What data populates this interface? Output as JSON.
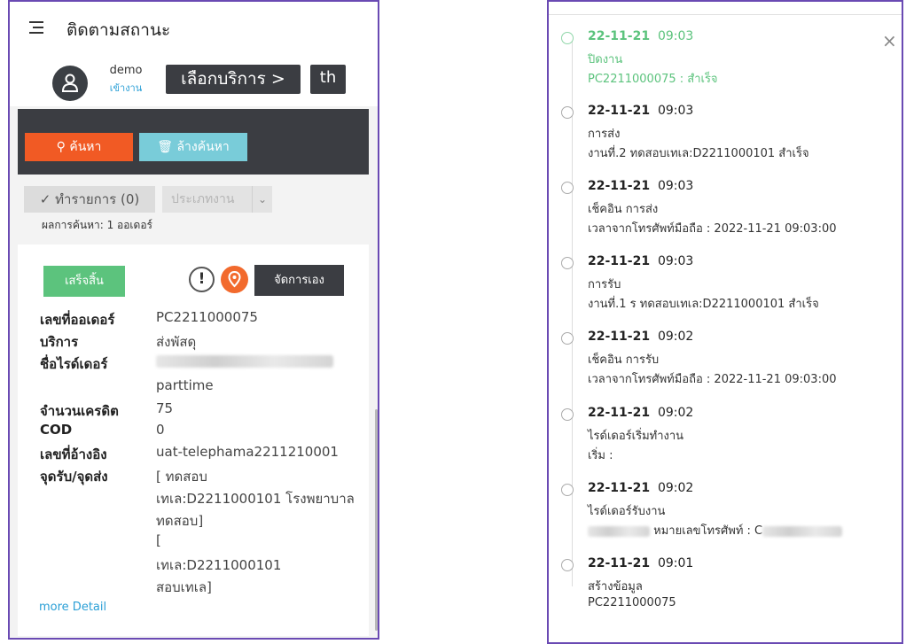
{
  "left": {
    "title": "ติดตามสถานะ",
    "user_name": "demo",
    "user_status": "เข้างาน",
    "service_button": "เลือกบริการ >",
    "lang_button": "th",
    "search_button": "ค้นหา",
    "clear_button": "ล้างค้นหา",
    "todo_button": "ทำรายการ (0)",
    "job_type_placeholder": "ประเภทงาน",
    "result_count": "ผลการค้นหา: 1 ออเดอร์",
    "card": {
      "status_badge": "เสร็จสิ้น",
      "manual_button": "จัดการเอง",
      "fields": [
        {
          "label": "เลขที่ออเดอร์",
          "value": "PC2211000075"
        },
        {
          "label": "บริการ",
          "value": "ส่งพัสดุ"
        },
        {
          "label": "ชื่อไรด์เดอร์",
          "value": ""
        },
        {
          "label": "",
          "value": "parttime"
        },
        {
          "label": "จำนวนเครดิต",
          "value": "75"
        },
        {
          "label": "COD",
          "value": "0"
        },
        {
          "label": "เลขที่อ้างอิง",
          "value": "uat-telephama2211210001"
        },
        {
          "label": "จุดรับ/จุดส่ง",
          "value": "[ ทดสอบ"
        }
      ],
      "address_lines": [
        "เทเล:D2211000101 โรงพยาบาล",
        "ทดสอบ]",
        "[",
        "เทเล:D2211000101",
        "สอบเทเล]"
      ],
      "more_detail": "more Detail"
    }
  },
  "timeline": [
    {
      "date": "22-11-21",
      "time": "09:03",
      "line1": "ปิดงาน",
      "line2": "PC2211000075 : สำเร็จ"
    },
    {
      "date": "22-11-21",
      "time": "09:03",
      "line1": "การส่ง",
      "line2": "งานที่.2        ทดสอบเทเล:D2211000101 สำเร็จ"
    },
    {
      "date": "22-11-21",
      "time": "09:03",
      "line1": "เช็คอิน การส่ง",
      "line2": "เวลาจากโทรศัพท์มือถือ : 2022-11-21 09:03:00"
    },
    {
      "date": "22-11-21",
      "time": "09:03",
      "line1": "การรับ",
      "line2": "งานที่.1        ร ทดสอบเทเล:D2211000101 สำเร็จ"
    },
    {
      "date": "22-11-21",
      "time": "09:02",
      "line1": "เช็คอิน การรับ",
      "line2": "เวลาจากโทรศัพท์มือถือ : 2022-11-21 09:03:00"
    },
    {
      "date": "22-11-21",
      "time": "09:02",
      "line1": "ไรด์เดอร์เริ่มทำงาน",
      "line2": "เริ่ม :"
    },
    {
      "date": "22-11-21",
      "time": "09:02",
      "line1": "ไรด์เดอร์รับงาน",
      "line2": "หมายเลขโทรศัพท์ : C"
    },
    {
      "date": "22-11-21",
      "time": "09:01",
      "line1": "สร้างข้อมูล",
      "line2": "PC2211000075"
    }
  ],
  "close_label": "×"
}
